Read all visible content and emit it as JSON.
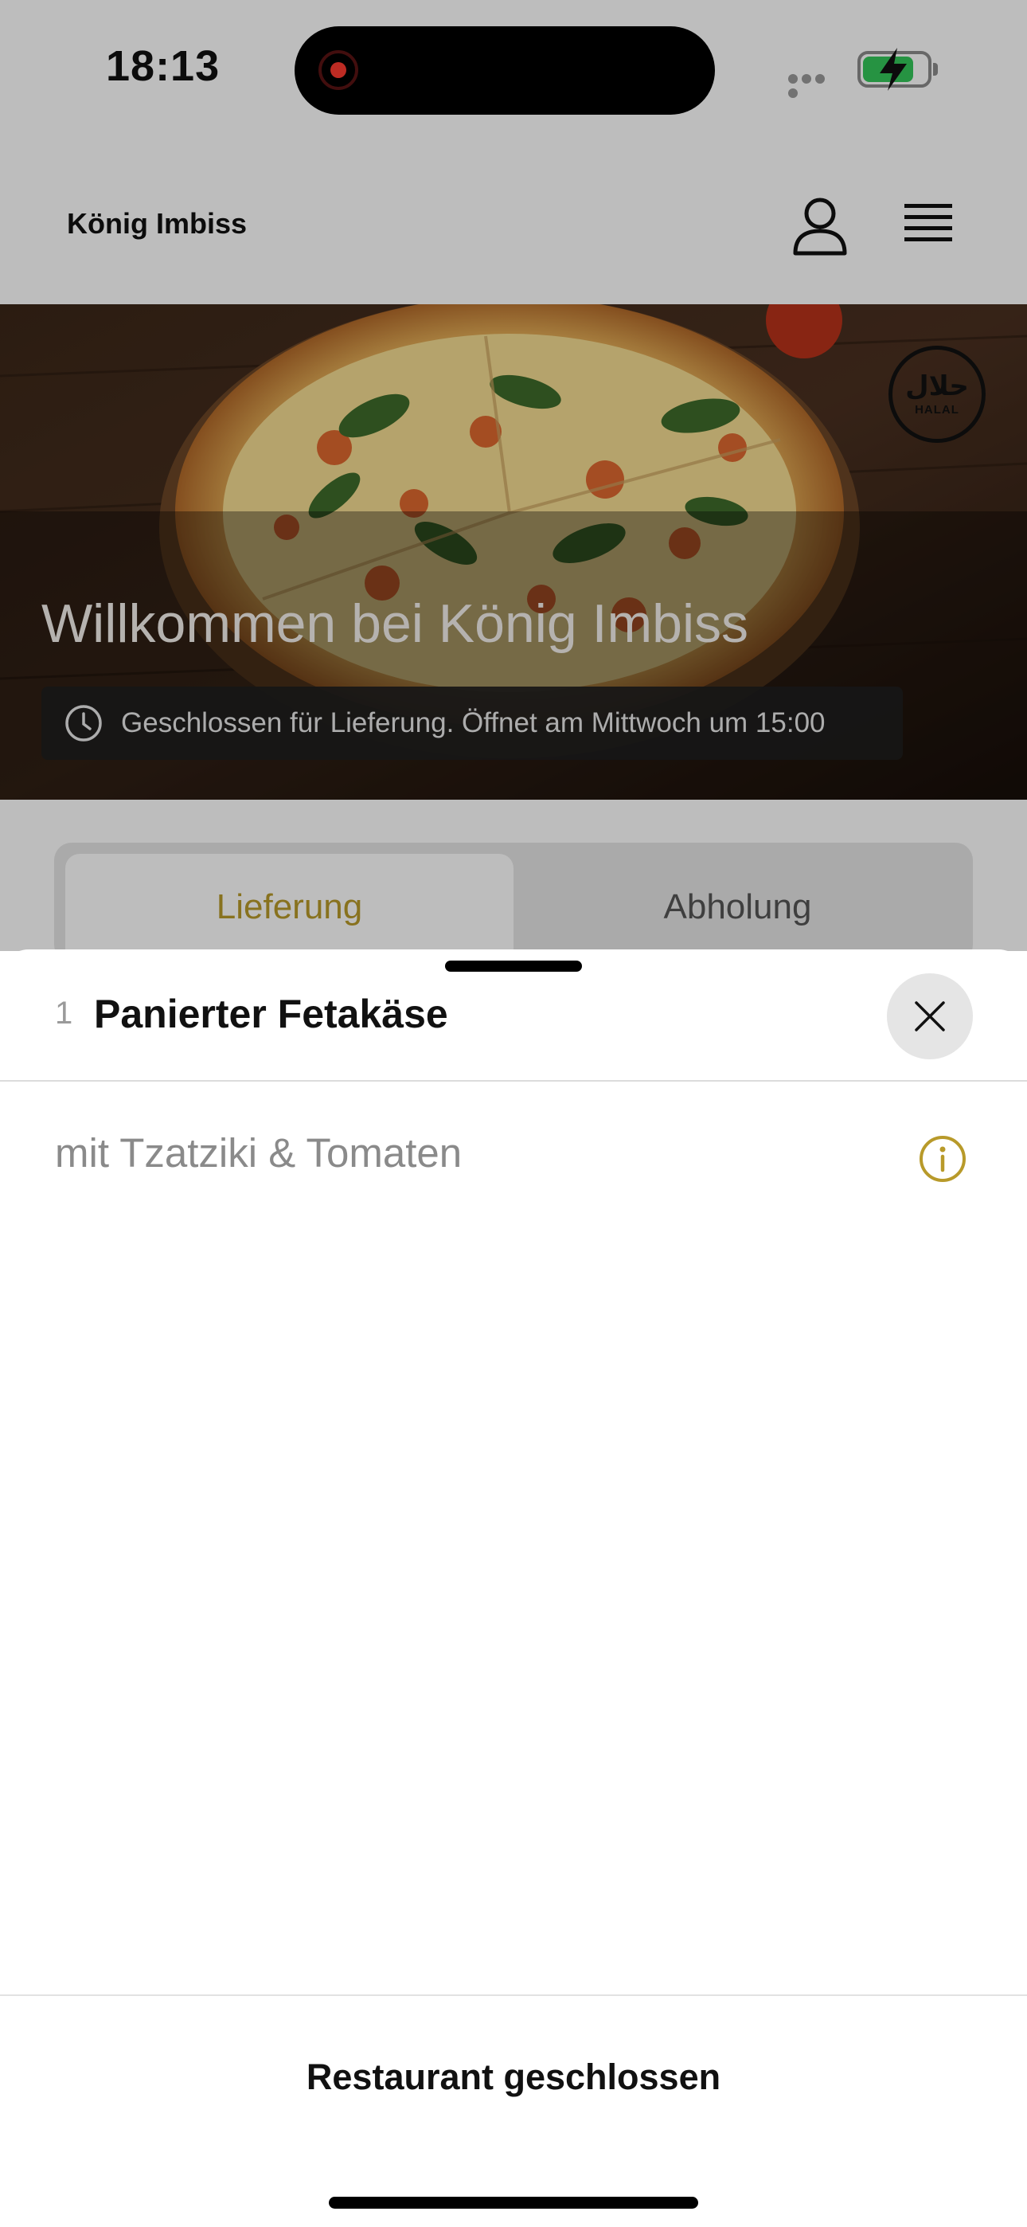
{
  "status_bar": {
    "time": "18:13",
    "battery_level": 0.8,
    "battery_color": "#34c759",
    "recording_color": "#ff3b30"
  },
  "header": {
    "brand": "König Imbiss",
    "icons": [
      "user-icon",
      "menu-icon"
    ]
  },
  "hero": {
    "title": "Willkommen bei König Imbiss",
    "badge_arabic": "حلال",
    "badge_latin": "HALAL",
    "notice": "Geschlossen für Lieferung. Öffnet am Mittwoch um 15:00"
  },
  "order_tabs": {
    "active": "Lieferung",
    "inactive": "Abholung",
    "active_color": "#b89a2a"
  },
  "sheet": {
    "quantity": "1",
    "title": "Panierter Fetakäse",
    "description": "mit Tzatziki & Tomaten",
    "footer_label": "Restaurant geschlossen",
    "accent_color": "#b89a2a"
  }
}
